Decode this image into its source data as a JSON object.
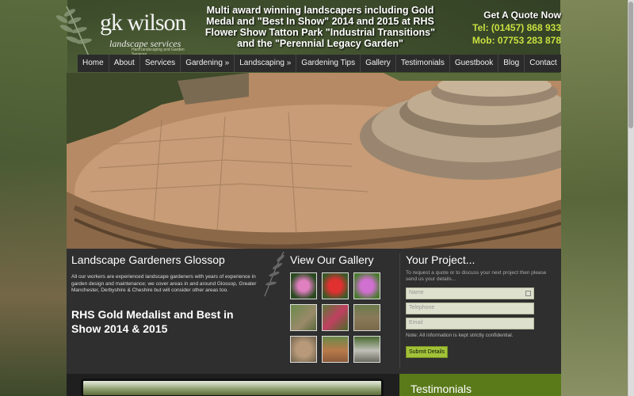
{
  "header": {
    "logo_name": "gk wilson",
    "logo_sub": "landscape services",
    "logo_tag": "Hard landscaping and Garden Services",
    "award_lines": [
      "Multi award winning landscapers including Gold",
      "Medal and \"Best In Show\" 2014 and 2015 at RHS",
      "Flower Show Tatton Park \"Industrial Transitions\"",
      "and the \"Perennial Legacy Garden\""
    ],
    "quote_title": "Get A Quote Now",
    "tel": "Tel: (01457) 868 933",
    "mob": "Mob: 07753 283 878"
  },
  "nav": {
    "items": [
      "Home",
      "About",
      "Services",
      "Gardening »",
      "Landscaping »",
      "Gardening Tips",
      "Gallery",
      "Testimonials",
      "Guestbook",
      "Blog",
      "Contact"
    ]
  },
  "intro": {
    "title": "Landscape Gardeners Glossop",
    "text": "All our workers are experienced landscape gardeners with years of experience in garden design and maintenance; we cover areas in and around Glossop, Greater Manchester, Derbyshire & Cheshire but will consider other areas too.",
    "medal": "RHS Gold Medalist and Best in Show 2014 & 2015"
  },
  "gallery": {
    "title": "View Our Gallery"
  },
  "project": {
    "title": "Your Project...",
    "intro": "To request a quote or to discuss your next project then please send us your details...",
    "name_placeholder": "Name",
    "phone_placeholder": "Telephone",
    "email_placeholder": "Email",
    "note": "Note: All information is kept strictly confidential.",
    "submit": "Submit Details"
  },
  "testimonials": {
    "title": "Testimonials"
  },
  "colors": {
    "accent_green": "#a2c238",
    "phone_green": "#c8e040",
    "panel": "#2f2f2f"
  }
}
